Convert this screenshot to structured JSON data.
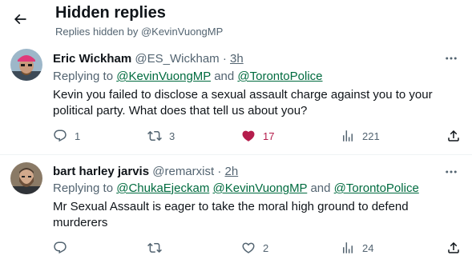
{
  "header": {
    "title": "Hidden replies",
    "subtitle": "Replies hidden by @KevinVuongMP"
  },
  "colors": {
    "text": "#0f1419",
    "secondary": "#536471",
    "mention": "#006b3f",
    "like_active": "#b51d4c",
    "divider": "#eff3f4"
  },
  "tweets": [
    {
      "name": "Eric Wickham",
      "handle": "@ES_Wickham",
      "separator": "·",
      "time": "3h",
      "replying_prefix": "Replying to",
      "mentions": [
        "@KevinVuongMP",
        "@TorontoPolice"
      ],
      "joiner": "and",
      "text": "Kevin you failed to disclose a sexual assault charge against you to your political party. What does that tell us about you?",
      "replies": "1",
      "retweets": "3",
      "likes": "17",
      "liked": true,
      "views": "221",
      "avatar_icon": "avatar-pink-hat"
    },
    {
      "name": "bart harley jarvis",
      "handle": "@remarxist",
      "separator": "·",
      "time": "2h",
      "replying_prefix": "Replying to",
      "mentions": [
        "@ChukaEjeckam",
        "@KevinVuongMP",
        "@TorontoPolice"
      ],
      "joiner": "and",
      "text": "Mr Sexual Assault is eager to take the moral high ground to defend murderers",
      "replies": "",
      "retweets": "",
      "likes": "2",
      "liked": false,
      "views": "24",
      "avatar_icon": "avatar-bearded-man"
    }
  ]
}
